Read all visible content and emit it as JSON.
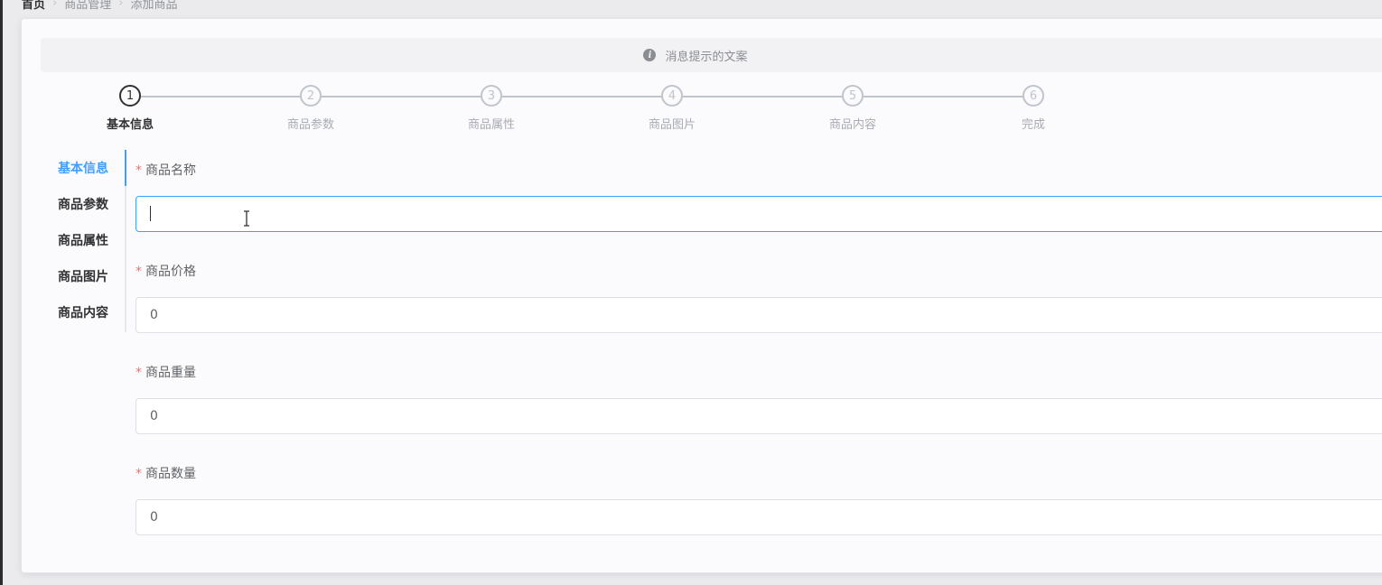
{
  "breadcrumb": [
    "首页",
    "商品管理",
    "添加商品"
  ],
  "alert": {
    "text": "消息提示的文案",
    "icon": "info-icon"
  },
  "steps": [
    {
      "num": "1",
      "label": "基本信息"
    },
    {
      "num": "2",
      "label": "商品参数"
    },
    {
      "num": "3",
      "label": "商品属性"
    },
    {
      "num": "4",
      "label": "商品图片"
    },
    {
      "num": "5",
      "label": "商品内容"
    },
    {
      "num": "6",
      "label": "完成"
    }
  ],
  "active_step": 1,
  "tabs": [
    "基本信息",
    "商品参数",
    "商品属性",
    "商品图片",
    "商品内容"
  ],
  "active_tab": 1,
  "form": {
    "required_mark": "*",
    "fields": [
      {
        "label": "商品名称",
        "value": ""
      },
      {
        "label": "商品价格",
        "value": "0"
      },
      {
        "label": "商品重量",
        "value": "0"
      },
      {
        "label": "商品数量",
        "value": "0"
      }
    ]
  },
  "colors": {
    "accent": "#409eff",
    "required": "#f56c6c",
    "text": "#303133",
    "muted": "#a8abb2"
  }
}
